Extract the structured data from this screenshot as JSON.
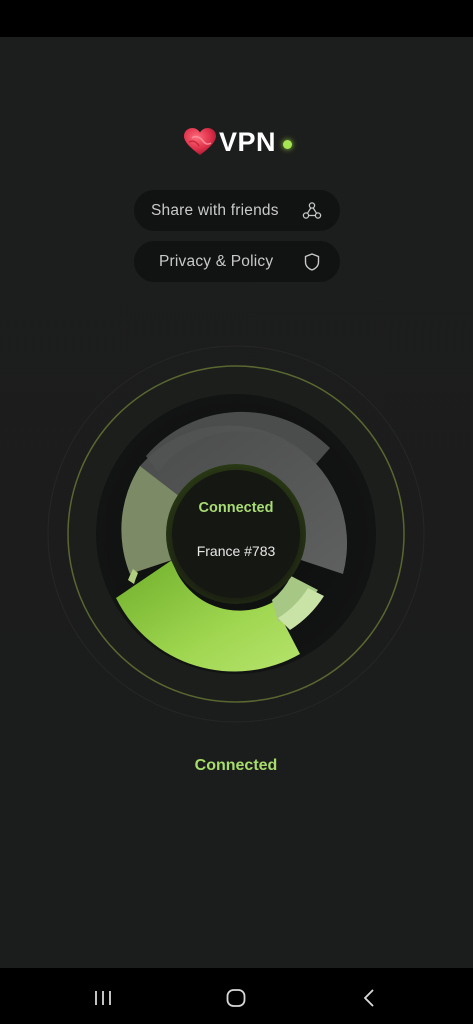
{
  "app": {
    "logo_text": "VPN",
    "accent_color": "#a6e552",
    "brand_heart_color": "#e0324b"
  },
  "menu": {
    "share": {
      "label": "Share with friends",
      "icon": "share-nodes-icon"
    },
    "privacy": {
      "label": "Privacy & Policy",
      "icon": "shield-icon"
    }
  },
  "connection": {
    "status_inner": "Connected",
    "server": "France #783",
    "status_label": "Connected"
  },
  "navigation": {
    "recents_icon": "recents-icon",
    "home_icon": "home-icon",
    "back_icon": "back-icon"
  }
}
